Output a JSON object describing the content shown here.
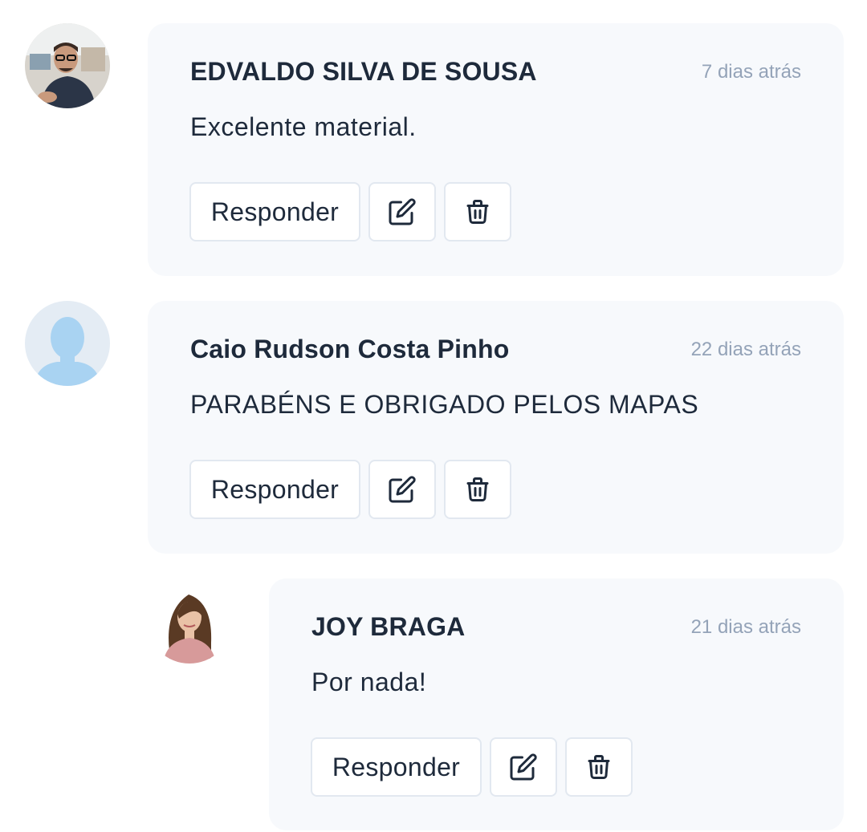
{
  "comments": [
    {
      "author": "EDVALDO SILVA DE SOUSA",
      "time": "7 dias atrás",
      "text": "Excelente material.",
      "reply_label": "Responder",
      "edit_icon": "edit-icon",
      "delete_icon": "trash-icon"
    },
    {
      "author": "Caio Rudson Costa Pinho",
      "time": "22 dias atrás",
      "text": "PARABÉNS E OBRIGADO PELOS MAPAS",
      "reply_label": "Responder",
      "edit_icon": "edit-icon",
      "delete_icon": "trash-icon"
    },
    {
      "author": "JOY BRAGA",
      "time": "21 dias atrás",
      "text": "Por nada!",
      "reply_label": "Responder",
      "edit_icon": "edit-icon",
      "delete_icon": "trash-icon"
    }
  ],
  "colors": {
    "card_bg": "#f7f9fc",
    "text": "#1e2a3b",
    "muted": "#94a3b8",
    "border": "#e2e8f0"
  }
}
